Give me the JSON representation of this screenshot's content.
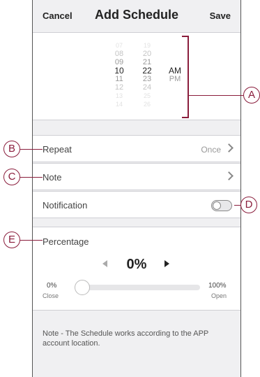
{
  "header": {
    "cancel_label": "Cancel",
    "title": "Add Schedule",
    "save_label": "Save"
  },
  "time_picker": {
    "hours": [
      "07",
      "08",
      "09",
      "10",
      "11",
      "12",
      "13",
      "14"
    ],
    "minutes": [
      "19",
      "20",
      "21",
      "22",
      "23",
      "24",
      "25",
      "26"
    ],
    "selected_hour": "10",
    "selected_minute": "22",
    "periods": [
      "AM",
      "PM"
    ],
    "selected_period": "AM"
  },
  "rows": {
    "repeat": {
      "label": "Repeat",
      "value": "Once"
    },
    "note": {
      "label": "Note"
    },
    "notification": {
      "label": "Notification",
      "enabled": false
    }
  },
  "percentage": {
    "label": "Percentage",
    "value": "0%",
    "level": 0,
    "min_label": "0%",
    "min_caption": "Close",
    "max_label": "100%",
    "max_caption": "Open"
  },
  "footer_note": "Note - The Schedule works according to the APP account location.",
  "callouts": [
    "A",
    "B",
    "C",
    "D",
    "E"
  ],
  "colors": {
    "accent": "#8a1d3c",
    "panel_bg": "#f0f0f2"
  }
}
